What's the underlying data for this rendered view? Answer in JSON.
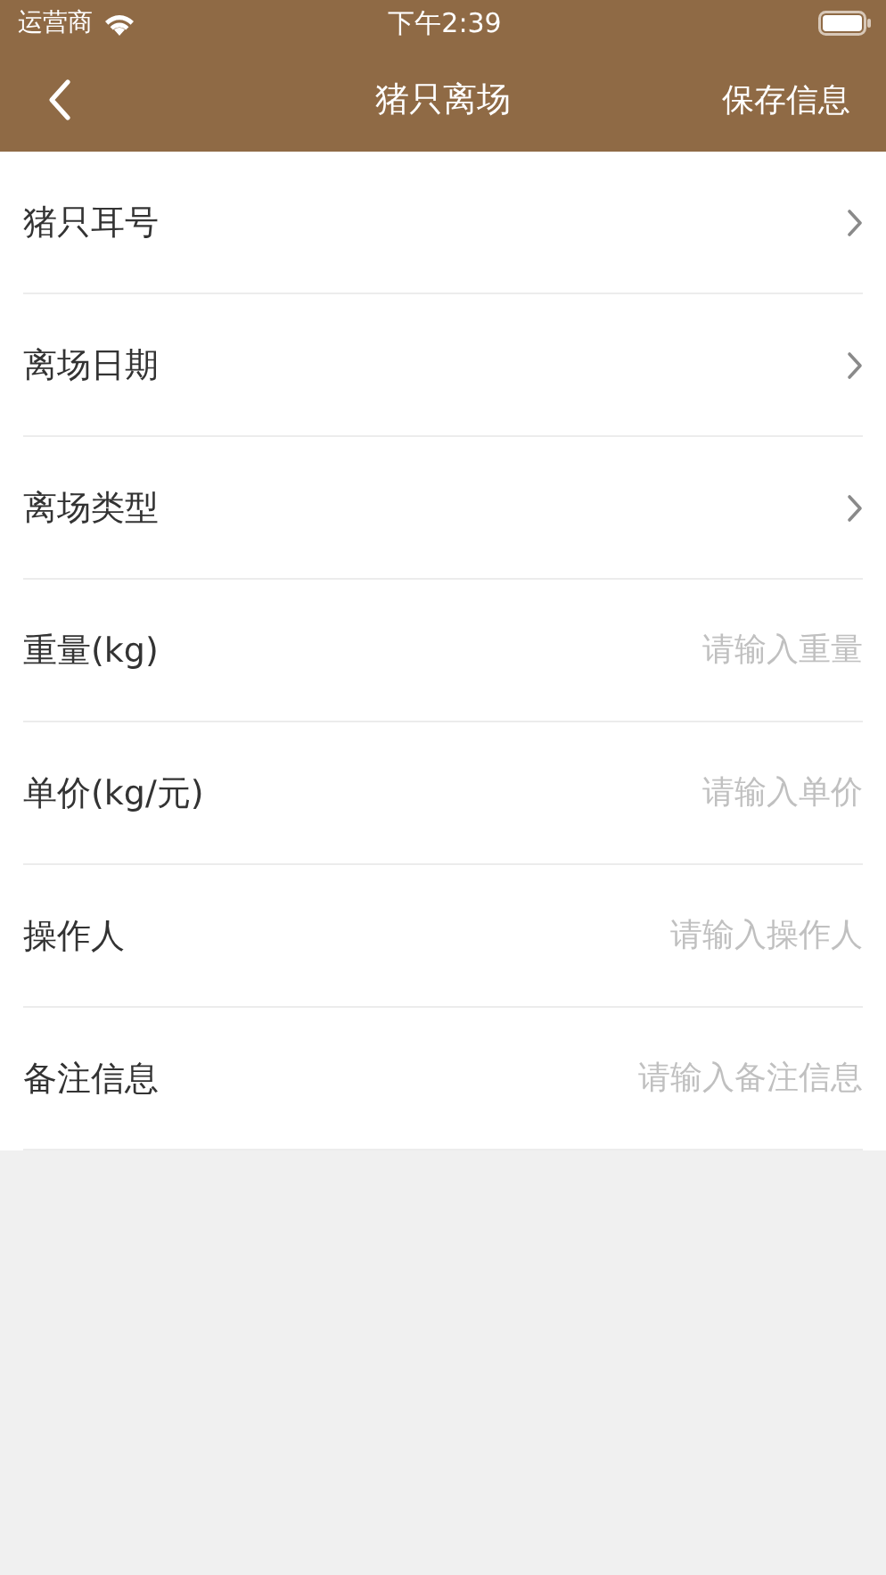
{
  "status_bar": {
    "carrier": "运营商",
    "time": "下午2:39"
  },
  "nav": {
    "title": "猪只离场",
    "action": "保存信息"
  },
  "fields": [
    {
      "kind": "select",
      "label": "猪只耳号"
    },
    {
      "kind": "select",
      "label": "离场日期"
    },
    {
      "kind": "select",
      "label": "离场类型"
    },
    {
      "kind": "input",
      "label": "重量(kg)",
      "placeholder": "请输入重量"
    },
    {
      "kind": "input",
      "label": "单价(kg/元)",
      "placeholder": "请输入单价"
    },
    {
      "kind": "input",
      "label": "操作人",
      "placeholder": "请输入操作人"
    },
    {
      "kind": "input",
      "label": "备注信息",
      "placeholder": "请输入备注信息"
    }
  ]
}
